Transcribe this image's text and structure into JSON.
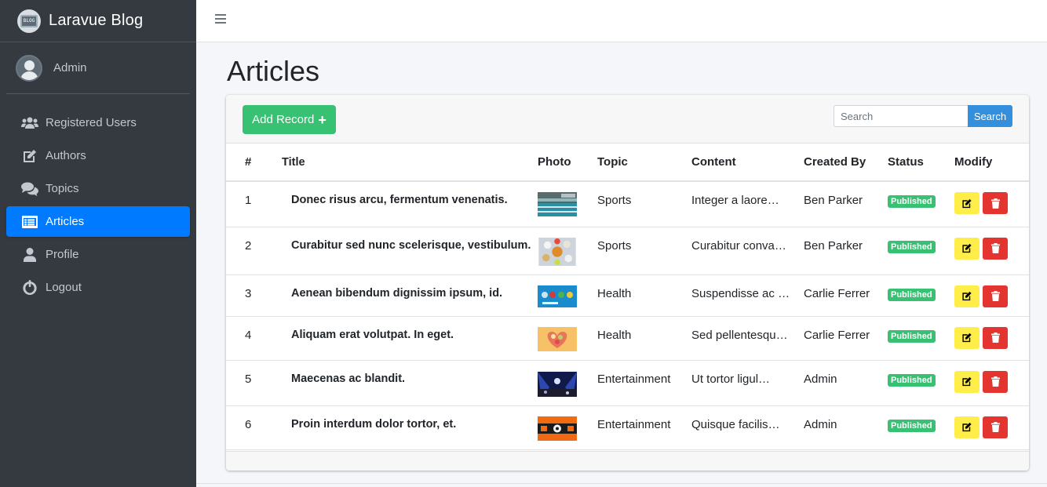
{
  "brand": {
    "title": "Laravue Blog",
    "logo_text": "BLOG"
  },
  "user": {
    "name": "Admin"
  },
  "sidebar": {
    "items": [
      {
        "label": "Registered Users",
        "icon": "users-icon",
        "active": false
      },
      {
        "label": "Authors",
        "icon": "edit-icon",
        "active": false
      },
      {
        "label": "Topics",
        "icon": "comments-icon",
        "active": false
      },
      {
        "label": "Articles",
        "icon": "list-alt-icon",
        "active": true
      },
      {
        "label": "Profile",
        "icon": "user-icon",
        "active": false
      },
      {
        "label": "Logout",
        "icon": "power-off-icon",
        "active": false
      }
    ]
  },
  "main": {
    "page_title": "Articles",
    "add_button_label": "Add Record",
    "search": {
      "placeholder": "Search",
      "value": "",
      "button_label": "Search"
    },
    "table": {
      "headers": [
        "#",
        "Title",
        "Photo",
        "Topic",
        "Content",
        "Created By",
        "Status",
        "Modify"
      ],
      "rows": [
        {
          "num": "1",
          "title": "Donec risus arcu, fermentum venenatis.",
          "topic": "Sports",
          "content": "Integer a laore…",
          "created_by": "Ben Parker",
          "status": "Published"
        },
        {
          "num": "2",
          "title": "Curabitur sed nunc scelerisque, vestibulum.",
          "topic": "Sports",
          "content": "Curabitur conva…",
          "created_by": "Ben Parker",
          "status": "Published"
        },
        {
          "num": "3",
          "title": "Aenean bibendum dignissim ipsum, id.",
          "topic": "Health",
          "content": "Suspendisse ac …",
          "created_by": "Carlie Ferrer",
          "status": "Published"
        },
        {
          "num": "4",
          "title": "Aliquam erat volutpat. In eget.",
          "topic": "Health",
          "content": "Sed pellentesqu…",
          "created_by": "Carlie Ferrer",
          "status": "Published"
        },
        {
          "num": "5",
          "title": "Maecenas ac blandit.",
          "topic": "Entertainment",
          "content": "Ut tortor ligul…",
          "created_by": "Admin",
          "status": "Published"
        },
        {
          "num": "6",
          "title": "Proin interdum dolor tortor, et.",
          "topic": "Entertainment",
          "content": "Quisque facilis…",
          "created_by": "Admin",
          "status": "Published"
        }
      ]
    }
  },
  "colors": {
    "sidebar_bg": "#343a40",
    "active_nav": "#007bff",
    "add_button": "#38c172",
    "search_button": "#3490dc",
    "badge_published": "#38c172",
    "edit_button": "#ffed4a",
    "delete_button": "#e3342f"
  }
}
